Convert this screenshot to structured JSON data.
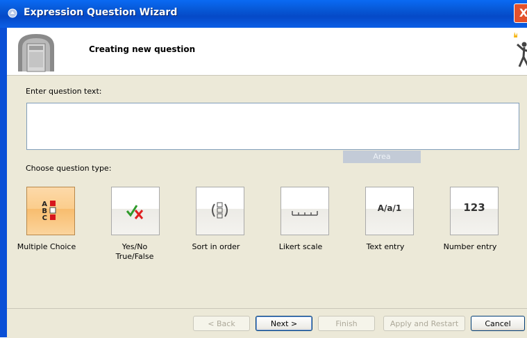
{
  "window": {
    "title": "Expression Question Wizard",
    "close_glyph": "X"
  },
  "header": {
    "title": "Creating new question"
  },
  "form": {
    "question_label": "Enter question text:",
    "question_value": "",
    "area_tab": "Area",
    "type_label": "Choose question type:"
  },
  "question_types": [
    {
      "label": "Multiple Choice",
      "icon": "multiple-choice-icon",
      "selected": true
    },
    {
      "label": "Yes/No True/False",
      "icon": "check-cross-icon",
      "selected": false
    },
    {
      "label": "Sort in order",
      "icon": "sort-order-icon",
      "selected": false
    },
    {
      "label": "Likert scale",
      "icon": "likert-scale-icon",
      "selected": false
    },
    {
      "label": "Text entry",
      "icon": "text-entry-icon",
      "tile_text": "A/a/1",
      "selected": false
    },
    {
      "label": "Number entry",
      "icon": "number-entry-icon",
      "tile_text": "123",
      "selected": false
    }
  ],
  "mc_letters": [
    "A",
    "B",
    "C"
  ],
  "buttons": {
    "back": "< Back",
    "next": "Next >",
    "finish": "Finish",
    "apply_restart": "Apply and Restart",
    "cancel": "Cancel"
  },
  "colors": {
    "titlebar": "#0758d6",
    "selected_tile": "#fbcd8c",
    "check": "#2e9a2a",
    "cross": "#e02020",
    "mc_square": "#d7161e"
  }
}
